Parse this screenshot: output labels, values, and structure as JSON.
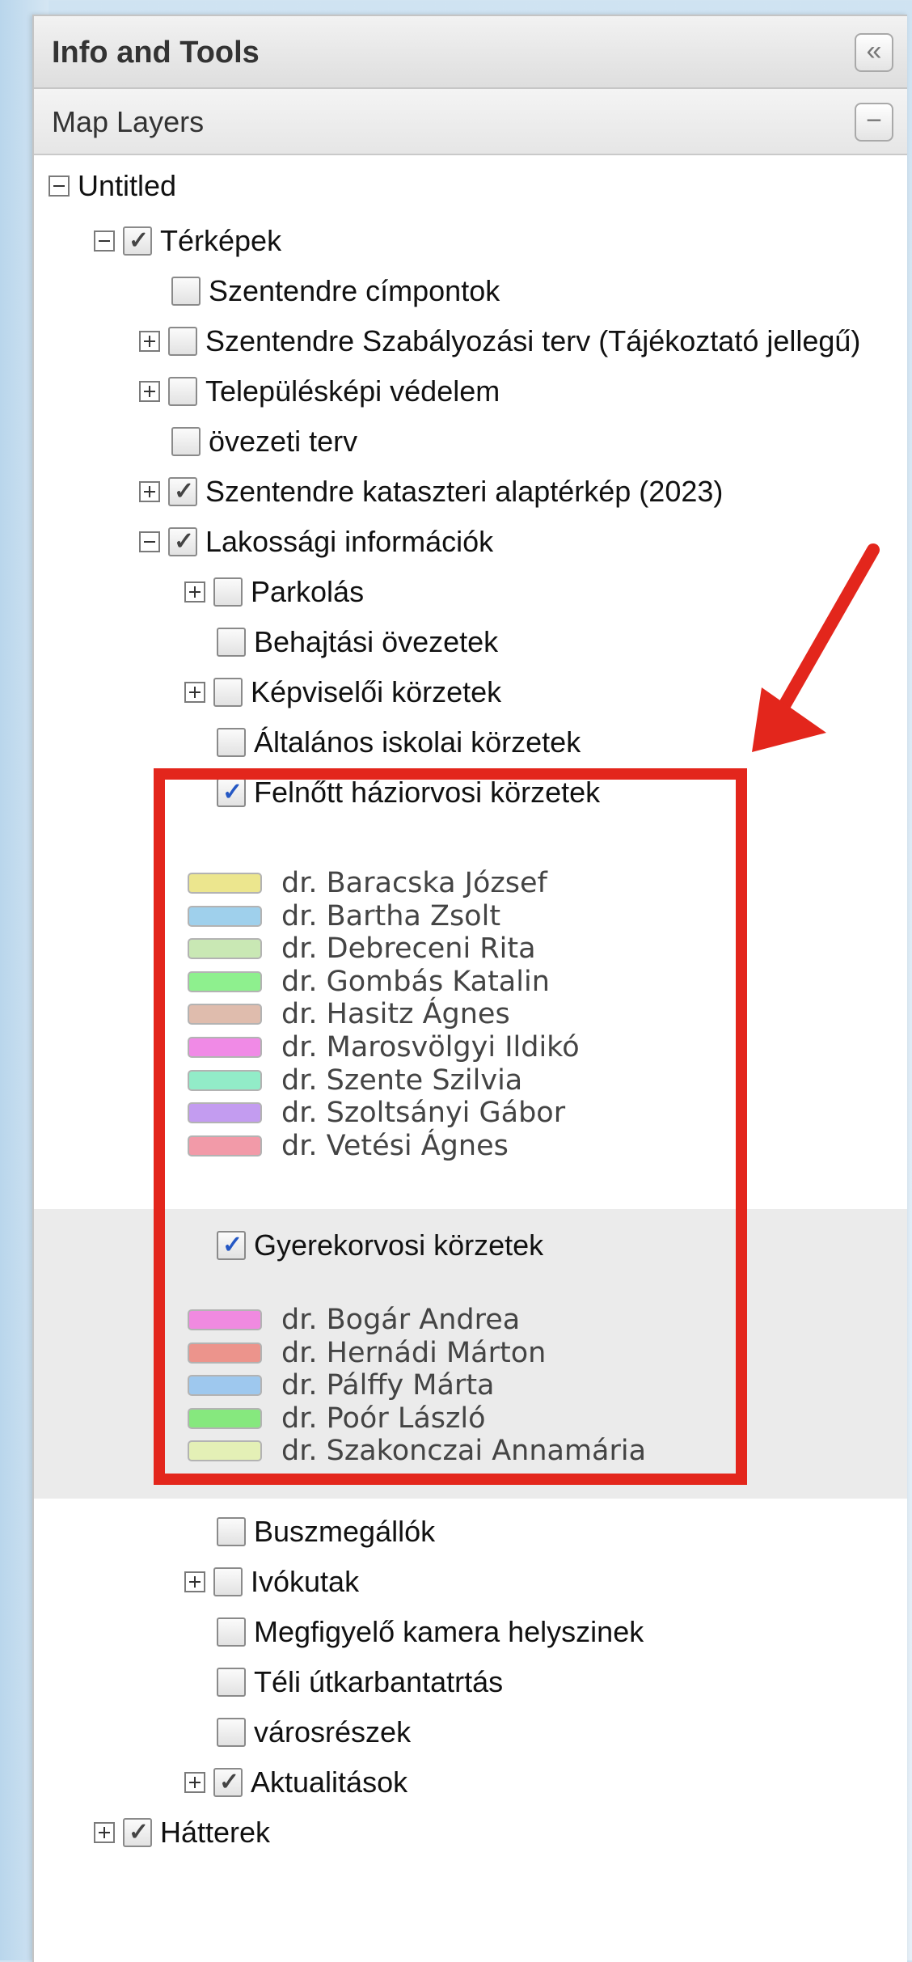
{
  "panel": {
    "title": "Info and Tools",
    "collapse_glyph": "«",
    "map_layers_label": "Map Layers",
    "minimize_glyph": "−"
  },
  "tree": {
    "root": "Untitled",
    "terkepek": "Térképek",
    "cimpontok": "Szentendre címpontok",
    "szabalyozasi": "Szentendre Szabályozási terv (Tájékoztató jellegű)",
    "telepuleskepi": "Településképi védelem",
    "ovezeti": "övezeti terv",
    "kataszteri": "Szentendre kataszteri alaptérkép (2023)",
    "lakossagi": "Lakossági információk",
    "parkolas": "Parkolás",
    "behajtasi": "Behajtási övezetek",
    "kepviseloi": "Képviselői körzetek",
    "altalanos": "Általános iskolai körzetek",
    "felnott": "Felnőtt háziorvosi körzetek",
    "gyerek": "Gyerekorvosi körzetek",
    "buszmegallok": "Buszmegállók",
    "ivokutak": "Ivókutak",
    "kamera": "Megfigyelő kamera helyszinek",
    "teli": "Téli útkarbantatrtás",
    "varosreszek": "városrészek",
    "aktualitasok": "Aktualitások",
    "hatterek": "Hátterek"
  },
  "felnott_legend": [
    {
      "label": "dr. Baracska József",
      "color": "#ece68e"
    },
    {
      "label": "dr. Bartha Zsolt",
      "color": "#9fd0ec"
    },
    {
      "label": "dr. Debreceni Rita",
      "color": "#c9e8b4"
    },
    {
      "label": "dr. Gombás Katalin",
      "color": "#8ef08e"
    },
    {
      "label": "dr. Hasitz Ágnes",
      "color": "#dfbcad"
    },
    {
      "label": "dr. Marosvölgyi Ildikó",
      "color": "#f08ae6"
    },
    {
      "label": "dr. Szente Szilvia",
      "color": "#92ecc8"
    },
    {
      "label": "dr. Szoltsányi Gábor",
      "color": "#c39cf0"
    },
    {
      "label": "dr. Vetési Ágnes",
      "color": "#f29aa8"
    }
  ],
  "gyerek_legend": [
    {
      "label": "dr. Bogár Andrea",
      "color": "#f08ae0"
    },
    {
      "label": "dr. Hernádi Márton",
      "color": "#ec948c"
    },
    {
      "label": "dr. Pálffy Márta",
      "color": "#9ec8ee"
    },
    {
      "label": "dr. Poór László",
      "color": "#86e87e"
    },
    {
      "label": "dr. Szakonczai Annamária",
      "color": "#e4f0b6"
    }
  ],
  "colors": {
    "highlight": "#e3261c"
  }
}
